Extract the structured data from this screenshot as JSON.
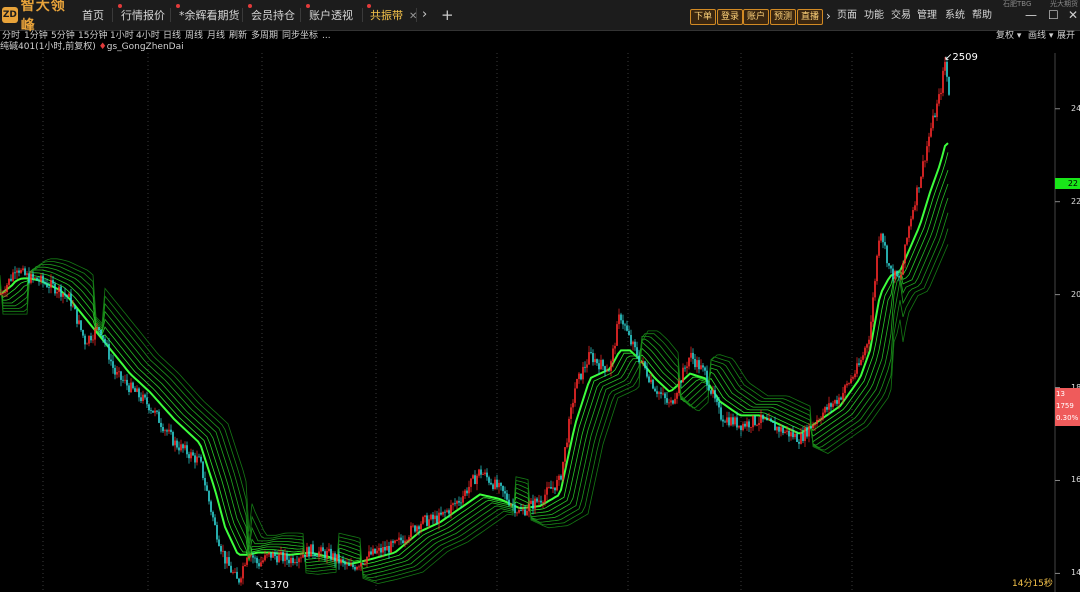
{
  "app": {
    "name": "智大领峰",
    "logo_glyph": "ZD",
    "accent": "#e8a33a"
  },
  "tabs": [
    {
      "label": "首页",
      "dot": false,
      "active": false
    },
    {
      "label": "行情报价",
      "dot": true,
      "active": false
    },
    {
      "label": "*余辉看期货",
      "dot": true,
      "active": false
    },
    {
      "label": "会员持仓",
      "dot": true,
      "active": false
    },
    {
      "label": "账户透视",
      "dot": true,
      "active": false
    },
    {
      "label": "共振带",
      "dot": true,
      "active": true,
      "close": "✕"
    }
  ],
  "nav": {
    "chevron": "›",
    "add": "+"
  },
  "order_buttons": [
    "下单",
    "登录",
    "账户",
    "预测",
    "直播"
  ],
  "menus": [
    "›",
    "页面",
    "功能",
    "交易",
    "管理",
    "系统",
    "帮助"
  ],
  "window_controls": {
    "minimize": "—",
    "maximize": "☐",
    "close": "✕"
  },
  "peek_text": [
    "石肥TBG",
    "光大期货"
  ],
  "timeframes": [
    "分时",
    "1分钟",
    "5分钟",
    "15分钟",
    "1小时",
    "4小时",
    "日线",
    "周线",
    "月线",
    "刷新",
    "多周期",
    "同步坐标",
    "..."
  ],
  "toolbar_right": {
    "adjust": "复权 ▾",
    "draw": "画线 ▾",
    "expand": "展开"
  },
  "instrument": {
    "label": "纯碱401(1小时,前复权)",
    "indicator_marker": "♦",
    "indicator": "gs_GongZhenDai"
  },
  "annotations": {
    "high": "2509",
    "low": "1370"
  },
  "price_axis": {
    "labels": [
      {
        "text": "24",
        "value": 2400
      },
      {
        "text": "22",
        "value": 2200
      },
      {
        "text": "20",
        "value": 2000
      },
      {
        "text": "18",
        "value": 1800
      },
      {
        "text": "16",
        "value": 1600
      },
      {
        "text": "14",
        "value": 1400
      }
    ],
    "green_tag": "22",
    "green_tag_value": 2240,
    "box": {
      "line1": "13",
      "line2": "1759",
      "line3": "0.30%"
    }
  },
  "status": {
    "timer": "14分15秒"
  },
  "chart_data": {
    "type": "line",
    "ylim": [
      1360,
      2520
    ],
    "high": 2509,
    "low": 1370,
    "x": [
      0,
      12,
      16,
      22,
      30,
      40,
      50,
      60,
      70,
      85,
      100,
      115,
      130,
      150,
      175,
      200,
      215,
      225,
      238,
      248,
      258,
      270,
      290,
      310,
      330,
      350,
      370,
      395,
      420,
      440,
      460,
      480,
      500,
      520,
      540,
      560,
      575,
      590,
      600,
      610,
      620,
      630,
      640,
      655,
      670,
      690,
      705,
      720,
      740,
      760,
      780,
      800,
      820,
      840,
      860,
      870,
      880,
      890,
      900,
      910,
      920,
      930,
      940,
      945,
      950
    ],
    "close": [
      2000,
      2040,
      2065,
      2045,
      2035,
      2030,
      2020,
      2010,
      1990,
      1900,
      1930,
      1830,
      1800,
      1760,
      1680,
      1640,
      1500,
      1430,
      1380,
      1450,
      1420,
      1440,
      1430,
      1450,
      1440,
      1410,
      1440,
      1460,
      1510,
      1520,
      1560,
      1620,
      1580,
      1530,
      1560,
      1600,
      1800,
      1870,
      1850,
      1840,
      1960,
      1900,
      1860,
      1800,
      1760,
      1870,
      1830,
      1740,
      1720,
      1730,
      1710,
      1690,
      1740,
      1780,
      1850,
      1920,
      2150,
      2050,
      2030,
      2160,
      2250,
      2350,
      2430,
      2500,
      2420
    ],
    "band": [
      2000,
      2020,
      2030,
      2035,
      2035,
      2030,
      2020,
      2010,
      1990,
      1950,
      1910,
      1870,
      1830,
      1790,
      1730,
      1680,
      1580,
      1500,
      1440,
      1440,
      1445,
      1445,
      1440,
      1445,
      1435,
      1420,
      1430,
      1445,
      1490,
      1510,
      1540,
      1570,
      1560,
      1540,
      1545,
      1570,
      1720,
      1820,
      1830,
      1840,
      1880,
      1880,
      1860,
      1820,
      1790,
      1830,
      1820,
      1770,
      1740,
      1740,
      1720,
      1700,
      1730,
      1760,
      1820,
      1880,
      2000,
      2040,
      2050,
      2100,
      2150,
      2220,
      2280,
      2320,
      2330
    ]
  }
}
